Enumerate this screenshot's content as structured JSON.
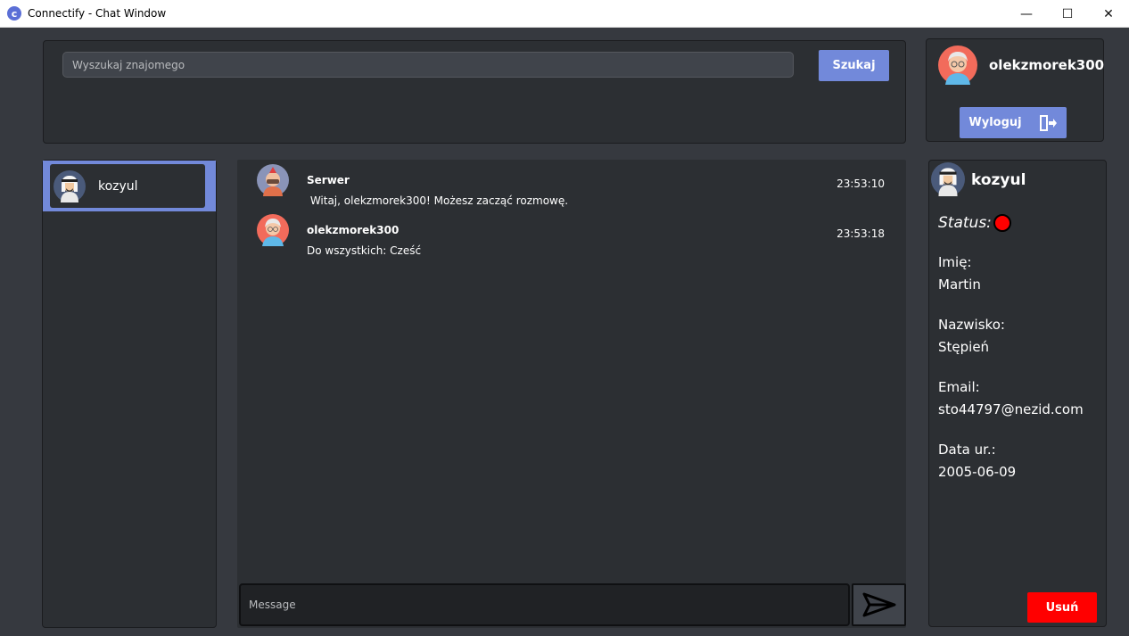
{
  "window": {
    "title": "Connectify - Chat Window",
    "icon_letter": "c",
    "minimize": "—",
    "maximize": "☐",
    "close": "✕"
  },
  "search": {
    "placeholder": "Wyszukaj znajomego",
    "button_label": "Szukaj"
  },
  "current_user": {
    "username": "olekzmorek300",
    "logout_label": "Wyloguj"
  },
  "friends": [
    {
      "name": "kozyul",
      "selected": true
    }
  ],
  "chat": {
    "messages": [
      {
        "author": "Serwer",
        "text": " Witaj, olekzmorek300! Możesz zacząć rozmowę.",
        "time": "23:53:10",
        "avatar": "server-avatar-icon"
      },
      {
        "author": "olekzmorek300",
        "text": "Do wszystkich: Cześć",
        "time": "23:53:18",
        "avatar": "user-avatar-icon"
      }
    ],
    "input_placeholder": "Message"
  },
  "profile": {
    "name": "kozyul",
    "status_label": "Status:",
    "status_color": "#ff0000",
    "fields": [
      {
        "label": "Imię:",
        "value": "Martin"
      },
      {
        "label": "Nazwisko:",
        "value": "Stępień"
      },
      {
        "label": "Email:",
        "value": "sto44797@nezid.com"
      },
      {
        "label": "Data ur.:",
        "value": "2005-06-09"
      }
    ],
    "delete_label": "Usuń"
  },
  "colors": {
    "accent": "#7289da",
    "background": "#36393f",
    "panel": "#2c2f33",
    "danger": "#ff0000"
  }
}
